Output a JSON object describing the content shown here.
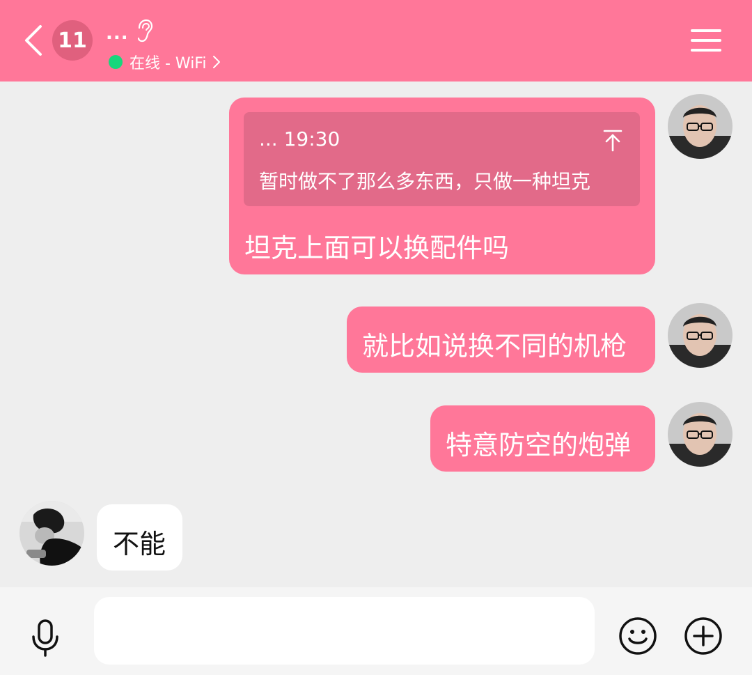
{
  "header": {
    "unread_count": "11",
    "contact_name": "...",
    "status_text": "在线 - WiFi",
    "icons": [
      "back-icon",
      "ear-icon",
      "chevron-right-icon",
      "menu-icon"
    ]
  },
  "messages": [
    {
      "direction": "outgoing",
      "quote": {
        "head": "... 19:30",
        "text": "暂时做不了那么多东西，只做一种坦克"
      },
      "text": "坦克上面可以换配件吗"
    },
    {
      "direction": "outgoing",
      "text": "就比如说换不同的机枪"
    },
    {
      "direction": "outgoing",
      "text": "特意防空的炮弹"
    },
    {
      "direction": "incoming",
      "text": "不能"
    }
  ],
  "composer": {
    "input_value": "",
    "icons": [
      "mic-icon",
      "emoji-icon",
      "plus-icon"
    ]
  },
  "colors": {
    "header": "#ff7799",
    "outgoing_bubble": "#ff7799",
    "quote_box": "#e26a89",
    "online_dot": "#17d77c",
    "background": "#eeeeee"
  }
}
